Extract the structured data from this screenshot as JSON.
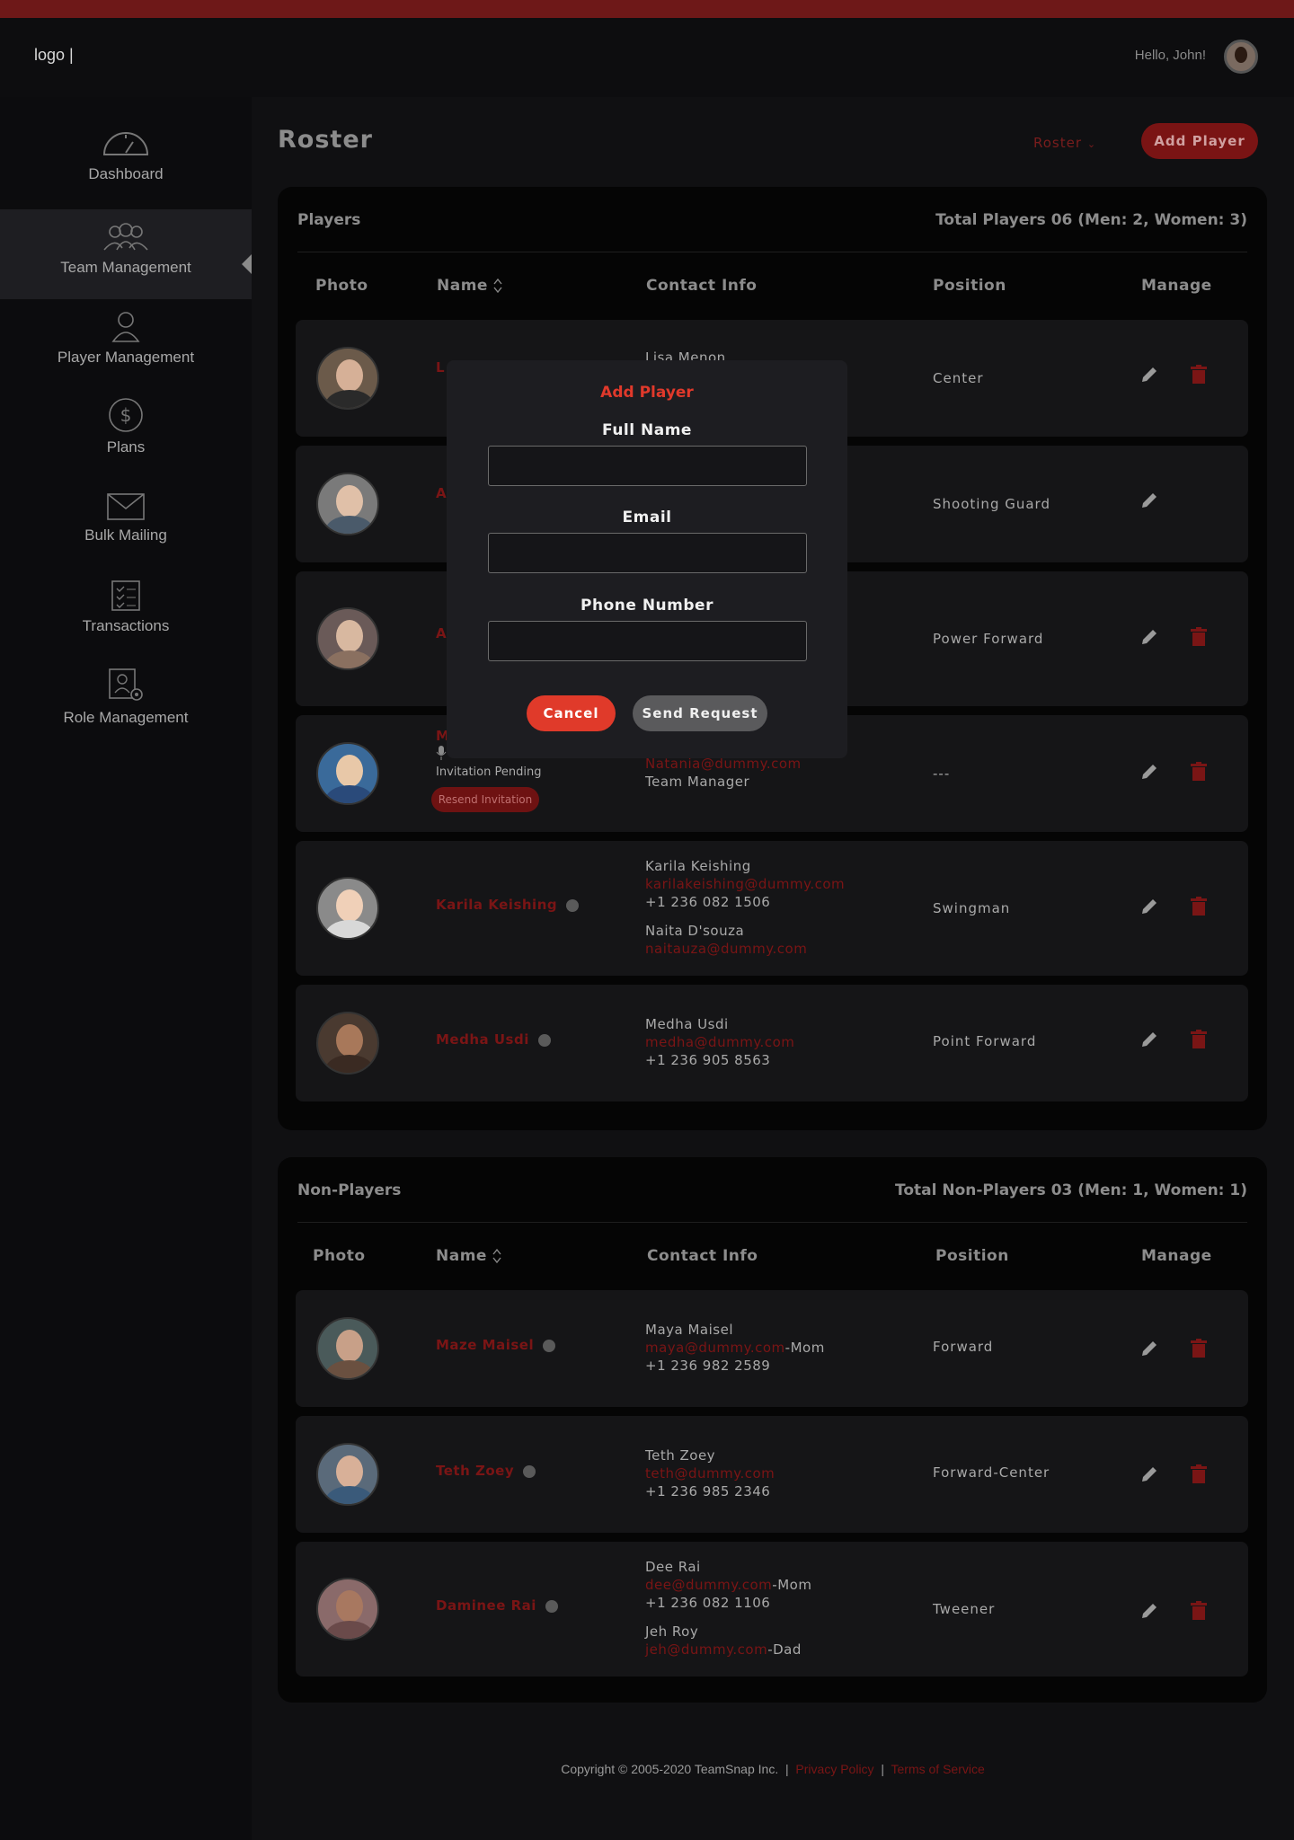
{
  "header": {
    "logo": "logo |",
    "greeting": "Hello, John!"
  },
  "sidebar": {
    "items": [
      {
        "label": "Dashboard",
        "icon": "dashboard-icon"
      },
      {
        "label": "Team Management",
        "icon": "team-icon"
      },
      {
        "label": "Player Management",
        "icon": "person-icon"
      },
      {
        "label": "Plans",
        "icon": "dollar-icon"
      },
      {
        "label": "Bulk Mailing",
        "icon": "mail-icon"
      },
      {
        "label": "Transactions",
        "icon": "checklist-icon"
      },
      {
        "label": "Role Management",
        "icon": "role-gear-icon"
      }
    ]
  },
  "main": {
    "title": "Roster",
    "view_select": "Roster",
    "add_player_label": "Add Player"
  },
  "players": {
    "title": "Players",
    "total": "Total Players 06 (Men: 2, Women: 3)",
    "columns": {
      "photo": "Photo",
      "name": "Name",
      "contact": "Contact Info",
      "position": "Position",
      "manage": "Manage"
    },
    "rows": [
      {
        "name_initial": "L",
        "contact_partial": "Lisa Menon",
        "position": "Center"
      },
      {
        "name_initial": "A",
        "position": "Shooting Guard"
      },
      {
        "name_initial": "A",
        "position": "Power Forward"
      },
      {
        "name_initial": "M",
        "invitation": "Invitation Pending",
        "resend": "Resend Invitation",
        "contact_email": "Natania@dummy.com",
        "contact_role": "Team Manager",
        "position": "---"
      },
      {
        "name": "Karila Keishing",
        "c1_name": "Karila Keishing",
        "c1_email": "karilakeishing@dummy.com",
        "c1_phone": "+1 236 082 1506",
        "c2_name": "Naita D'souza",
        "c2_email": "naitauza@dummy.com",
        "position": "Swingman"
      },
      {
        "name": "Medha Usdi",
        "c1_name": "Medha Usdi",
        "c1_email": "medha@dummy.com",
        "c1_phone": "+1 236 905 8563",
        "position": "Point Forward"
      }
    ]
  },
  "nonplayers": {
    "title": "Non-Players",
    "total": "Total Non-Players 03 (Men: 1, Women: 1)",
    "columns": {
      "photo": "Photo",
      "name": "Name",
      "contact": "Contact Info",
      "position": "Position",
      "manage": "Manage"
    },
    "rows": [
      {
        "name": "Maze Maisel",
        "c1_name": "Maya Maisel",
        "c1_email": "maya@dummy.com",
        "c1_rel": "-Mom",
        "c1_phone": "+1 236 982 2589",
        "position": "Forward"
      },
      {
        "name": "Teth Zoey",
        "c1_name": "Teth Zoey",
        "c1_email": "teth@dummy.com",
        "c1_phone": "+1 236 985 2346",
        "position": "Forward-Center"
      },
      {
        "name": "Daminee Rai",
        "c1_name": "Dee Rai",
        "c1_email": "dee@dummy.com",
        "c1_rel": "-Mom",
        "c1_phone": "+1 236 082 1106",
        "c2_name": "Jeh Roy",
        "c2_email": "jeh@dummy.com",
        "c2_rel": "-Dad",
        "position": "Tweener"
      }
    ]
  },
  "footer": {
    "copyright": "Copyright © 2005-2020 TeamSnap Inc.",
    "sep": "|",
    "privacy": "Privacy Policy",
    "terms": "Terms of Service"
  },
  "modal": {
    "title": "Add Player",
    "full_name_label": "Full Name",
    "full_name_value": "",
    "email_label": "Email",
    "email_value": "",
    "phone_label": "Phone Number",
    "phone_value": "",
    "cancel_label": "Cancel",
    "send_label": "Send Request"
  },
  "colors": {
    "accent": "#e03a2a",
    "dim_red": "#7a1515",
    "topbar": "#6e1818"
  }
}
